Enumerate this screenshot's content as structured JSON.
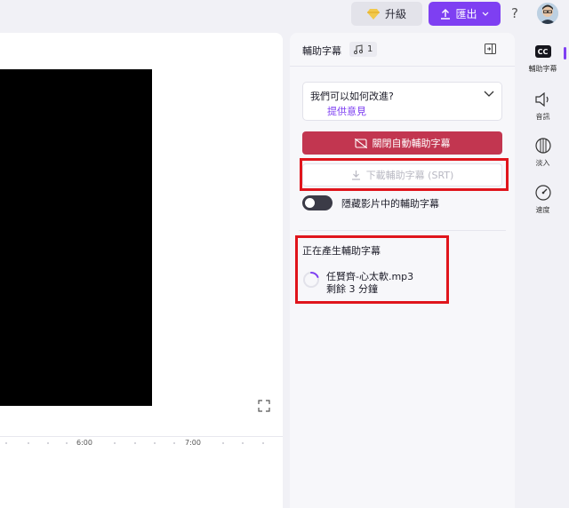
{
  "topbar": {
    "upgrade_label": "升級",
    "export_label": "匯出",
    "help_label": "?"
  },
  "preview": {
    "ruler_labels": [
      "6:00",
      "7:00"
    ]
  },
  "captions_panel": {
    "title": "輔助字幕",
    "track_count": "1",
    "feedback_question": "我們可以如何改進?",
    "feedback_link": "提供意見",
    "close_auto_button": "關閉自動輔助字幕",
    "download_button": "下載輔助字幕 (SRT)",
    "hide_toggle_label": "隱藏影片中的輔助字幕",
    "generating_title": "正在產生輔助字幕",
    "file_name": "任賢齊-心太軟.mp3",
    "remaining": "剩餘 3 分鐘"
  },
  "rail": {
    "items": [
      {
        "label": "輔助字幕",
        "icon": "cc-icon",
        "active": true
      },
      {
        "label": "音訊",
        "icon": "speaker-icon"
      },
      {
        "label": "淡入",
        "icon": "fade-icon"
      },
      {
        "label": "速度",
        "icon": "speed-icon"
      }
    ]
  },
  "colors": {
    "accent": "#7e3ff2",
    "danger_button": "#c23650",
    "highlight_box": "#e0151c"
  }
}
